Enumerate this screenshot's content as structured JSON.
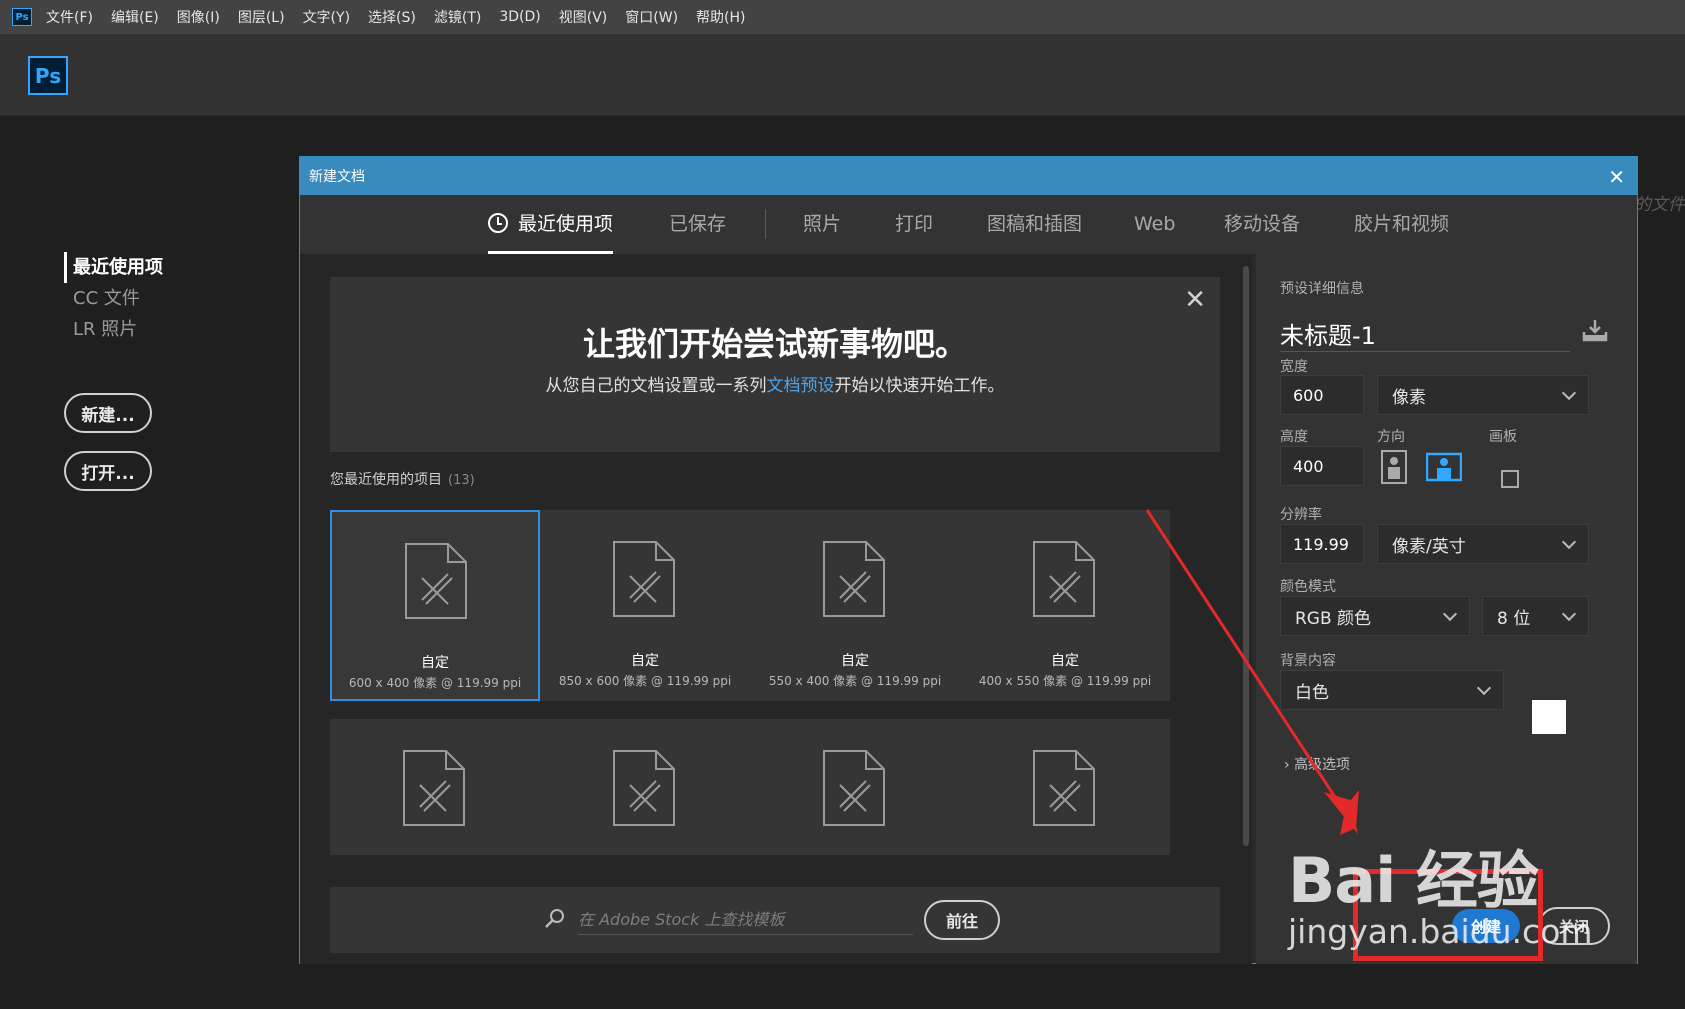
{
  "menubar": {
    "app_icon": "Ps",
    "items": [
      "文件(F)",
      "编辑(E)",
      "图像(I)",
      "图层(L)",
      "文字(Y)",
      "选择(S)",
      "滤镜(T)",
      "3D(D)",
      "视图(V)",
      "窗口(W)",
      "帮助(H)"
    ]
  },
  "topbar": {
    "logo": "Ps"
  },
  "start": {
    "nav": [
      "最近使用项",
      "CC 文件",
      "LR 照片"
    ],
    "new_label": "新建...",
    "open_label": "打开...",
    "ghost_text": "的文件"
  },
  "dialog": {
    "title": "新建文档",
    "tabs": [
      "最近使用项",
      "已保存",
      "照片",
      "打印",
      "图稿和插图",
      "Web",
      "移动设备",
      "胶片和视频"
    ],
    "welcome": {
      "heading": "让我们开始尝试新事物吧。",
      "line_before": "从您自己的文档设置或一系列",
      "line_link": "文档预设",
      "line_after": "开始以快速开始工作。"
    },
    "recent": {
      "heading": "您最近使用的项目",
      "count": "(13)"
    },
    "cards": [
      {
        "name": "自定",
        "meta": "600 x 400 像素 @ 119.99 ppi"
      },
      {
        "name": "自定",
        "meta": "850 x 600 像素 @ 119.99 ppi"
      },
      {
        "name": "自定",
        "meta": "550 x 400 像素 @ 119.99 ppi"
      },
      {
        "name": "自定",
        "meta": "400 x 550 像素 @ 119.99 ppi"
      }
    ],
    "stock": {
      "placeholder": "在 Adobe Stock 上查找模板",
      "go_label": "前往"
    },
    "preset": {
      "section_label": "预设详细信息",
      "doc_name": "未标题-1",
      "width_label": "宽度",
      "width_value": "600",
      "width_unit": "像素",
      "height_label": "高度",
      "height_value": "400",
      "orientation_label": "方向",
      "artboard_label": "画板",
      "resolution_label": "分辨率",
      "resolution_value": "119.99",
      "resolution_unit": "像素/英寸",
      "color_mode_label": "颜色模式",
      "color_mode": "RGB 颜色",
      "bit_depth": "8 位",
      "background_label": "背景内容",
      "background": "白色",
      "background_color": "#ffffff",
      "advanced_label": "高级选项",
      "create_label": "创建",
      "close_label": "关闭"
    }
  },
  "watermark": {
    "brand": "Bai 经验",
    "url": "jingyan.baidu.com"
  },
  "colors": {
    "accent": "#31a8ff",
    "title_bar": "#3a8bbd",
    "highlight": "#e32929",
    "primary_button": "#1f78d1"
  }
}
